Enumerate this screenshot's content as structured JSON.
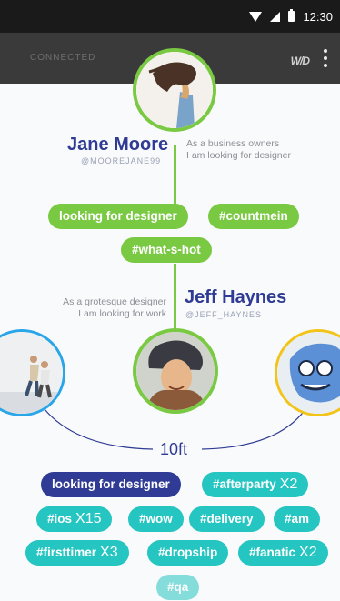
{
  "status_bar": {
    "time": "12:30",
    "icons": [
      "wifi-icon",
      "signal-icon",
      "battery-icon"
    ]
  },
  "app_bar": {
    "status": "CONNECTED",
    "logo": "W/D",
    "menu_icon": "overflow-menu-icon"
  },
  "colors": {
    "green": "#7ac943",
    "navy": "#2f3b94",
    "teal": "#25c5c2",
    "yellow": "#f2c318",
    "blue": "#2aa6e8"
  },
  "profiles": {
    "top": {
      "name": "Jane Moore",
      "handle": "@MOOREJANE99",
      "bio_line1": "As a business owners",
      "bio_line2": "I am looking for designer",
      "tags": [
        "looking for designer",
        "#countmein",
        "#what-s-hot"
      ]
    },
    "center": {
      "name": "Jeff Haynes",
      "handle": "@JEFF_HAYNES",
      "bio_line1": "As a grotesque designer",
      "bio_line2": "I am looking for work"
    }
  },
  "distance": "10ft",
  "matched_tags": [
    {
      "label": "looking for designer",
      "count": ""
    },
    {
      "label": "#afterparty",
      "count": "X2"
    },
    {
      "label": "#ios",
      "count": "X15"
    },
    {
      "label": "#wow",
      "count": ""
    },
    {
      "label": "#delivery",
      "count": ""
    },
    {
      "label": "#am",
      "count": ""
    },
    {
      "label": "#firsttimer",
      "count": "X3"
    },
    {
      "label": "#dropship",
      "count": ""
    },
    {
      "label": "#fanatic",
      "count": "X2"
    },
    {
      "label": "#qa",
      "count": ""
    }
  ]
}
